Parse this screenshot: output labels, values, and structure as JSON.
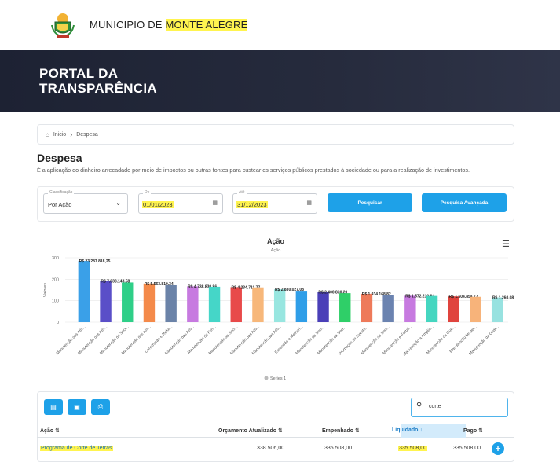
{
  "header": {
    "municipio_prefix": "MUNICIPIO DE ",
    "municipio_name": "MONTE ALEGRE"
  },
  "banner": {
    "title_line1": "PORTAL DA",
    "title_line2": "TRANSPARÊNCIA"
  },
  "breadcrumb": {
    "home": "Inicio",
    "current": "Despesa"
  },
  "page": {
    "title": "Despesa",
    "description": "É a aplicação do dinheiro arrecadado por meio de impostos ou outras fontes para custear os serviços públicos prestados à sociedade ou para a realização de investimentos."
  },
  "filters": {
    "classificacao_label": "Classificação",
    "classificacao_value": "Por Ação",
    "de_label": "De",
    "de_value": "01/01/2023",
    "ate_label": "Até",
    "ate_value": "31/12/2023",
    "pesquisar": "Pesquisar",
    "pesquisa_avancada": "Pesquisa Avançada"
  },
  "chart_data": {
    "type": "bar",
    "title": "Ação",
    "subtitle": "Ação",
    "ylabel": "Valores",
    "ylim": [
      0,
      300
    ],
    "yticks": [
      "0",
      "100",
      "200",
      "300"
    ],
    "legend": "Series 1",
    "categories": [
      "Manutenção das Ativ...",
      "Manutenção das Ativ...",
      "Manutenção da Secr...",
      "Manutenção das ativ...",
      "Construção e Refor...",
      "Manutenção das Ativ...",
      "Manutenção do Fun...",
      "Manutenção da Secr...",
      "Manutenção das Ativ...",
      "Manutenção das Ativ...",
      "Expansão e Melhori...",
      "Manutenção da Secr...",
      "Manutenção da Secr...",
      "Promoção de Evento...",
      "Manutenção da Secr...",
      "Manutenção e Fortal...",
      "Manutenção a Amplia...",
      "Manutenção da Gue...",
      "Manutenção Moder...",
      "Manutenção da Guar..."
    ],
    "values": [
      285,
      192,
      185,
      180,
      172,
      167,
      165,
      163,
      162,
      153,
      146,
      140,
      135,
      132,
      125,
      123,
      122,
      120,
      118,
      115
    ],
    "data_labels": [
      "R$ 23.287.818,25",
      "R$ 7.038.143,58",
      "",
      "R$ 5.563.810,34",
      "",
      "R$ 4.738.830,86",
      "",
      "R$ 4.234.711,77",
      "",
      "R$ 2.830.027,08",
      "",
      "R$ 2.400.830,20",
      "",
      "R$ 1.934.168,82",
      "",
      "R$ 1.572.210,84",
      "",
      "R$ 1.504.854,77",
      "",
      "R$ 1.260.084,03"
    ],
    "colors": [
      "#3aa0e8",
      "#5a4fc8",
      "#2fcf88",
      "#f48a4a",
      "#6b83a8",
      "#c77ae0",
      "#45d6c8",
      "#e84a4a",
      "#f7b77a",
      "#98e6e0",
      "#2f9ee8",
      "#4a3fb8",
      "#2fcf68",
      "#ee7a5a",
      "#6b83b0",
      "#c77ae0",
      "#45d6c0",
      "#e0443e",
      "#f7b37a",
      "#98e2e0"
    ],
    "grid": true
  },
  "table": {
    "headers": [
      "Ação",
      "Orçamento Atualizado",
      "Empenhado",
      "Liquidado",
      "Pago"
    ],
    "rows": [
      {
        "acao": "Programa de Corte de Terras",
        "orcamento": "338.506,00",
        "empenhado": "335.508,00",
        "liquidado": "335.508,00",
        "pago": "335.508,00"
      }
    ],
    "search_value": "corte"
  }
}
